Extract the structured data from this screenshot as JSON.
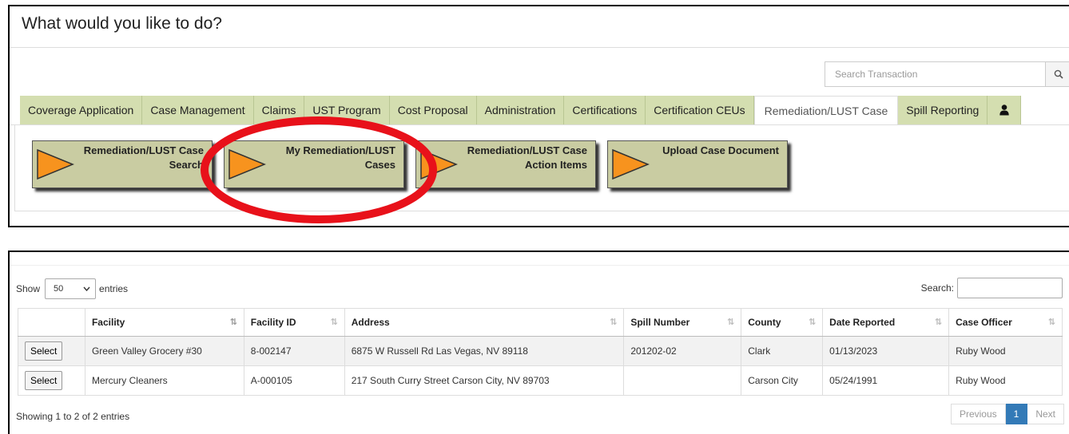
{
  "header": {
    "title": "What would you like to do?"
  },
  "search": {
    "placeholder": "Search Transaction",
    "icon": "search-icon"
  },
  "tabs": [
    {
      "label": "Coverage Application"
    },
    {
      "label": "Case Management"
    },
    {
      "label": "Claims"
    },
    {
      "label": "UST Program"
    },
    {
      "label": "Cost Proposal"
    },
    {
      "label": "Administration"
    },
    {
      "label": "Certifications"
    },
    {
      "label": "Certification CEUs"
    },
    {
      "label": "Remediation/LUST Case",
      "active": true
    },
    {
      "label": "Spill Reporting"
    },
    {
      "label": "",
      "icon": "user-icon"
    }
  ],
  "actions": [
    {
      "label_line1": "Remediation/LUST Case",
      "label_line2": "Search"
    },
    {
      "label_line1": "My Remediation/LUST",
      "label_line2": "Cases"
    },
    {
      "label_line1": "Remediation/LUST Case",
      "label_line2": "Action Items"
    },
    {
      "label_line1": "Upload Case Document",
      "label_line2": ""
    }
  ],
  "colors": {
    "tab_bg": "#d4deb0",
    "button_bg": "#c9cca2",
    "arrow": "#f7931e",
    "highlight": "#e8111a",
    "pager_active": "#337ab7"
  },
  "table_controls": {
    "show_label": "Show",
    "page_size": "50",
    "entries_label": "entries",
    "search_label": "Search:"
  },
  "table": {
    "columns": [
      "",
      "Facility",
      "Facility ID",
      "Address",
      "Spill Number",
      "County",
      "Date Reported",
      "Case Officer"
    ],
    "rows": [
      {
        "action": "Select",
        "facility": "Green Valley Grocery #30",
        "facility_id": "8-002147",
        "address": "6875 W Russell Rd Las Vegas, NV 89118",
        "spill_number": "201202-02",
        "county": "Clark",
        "date_reported": "01/13/2023",
        "case_officer": "Ruby Wood"
      },
      {
        "action": "Select",
        "facility": "Mercury Cleaners",
        "facility_id": "A-000105",
        "address": "217 South Curry Street Carson City, NV 89703",
        "spill_number": "",
        "county": "Carson City",
        "date_reported": "05/24/1991",
        "case_officer": "Ruby Wood"
      }
    ]
  },
  "footer": {
    "info": "Showing 1 to 2 of 2 entries",
    "previous": "Previous",
    "current_page": "1",
    "next": "Next"
  }
}
